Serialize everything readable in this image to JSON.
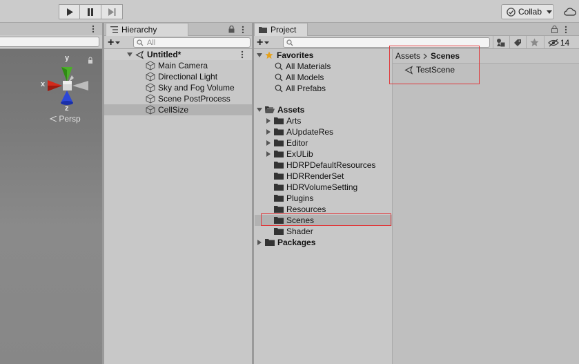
{
  "toolbar": {
    "play_icon": "play-icon",
    "pause_icon": "pause-icon",
    "step_icon": "step-icon",
    "collab_label": "Collab",
    "cloud_icon": "cloud-icon"
  },
  "scene": {
    "axis_y": "y",
    "axis_x": "x",
    "axis_z": "z",
    "projection_label": "Persp"
  },
  "hierarchy": {
    "tab_label": "Hierarchy",
    "search_placeholder": "All",
    "scene_name": "Untitled*",
    "items": [
      {
        "label": "Main Camera"
      },
      {
        "label": "Directional Light"
      },
      {
        "label": "Sky and Fog Volume"
      },
      {
        "label": "Scene PostProcess"
      },
      {
        "label": "CellSize"
      }
    ]
  },
  "project": {
    "tab_label": "Project",
    "hidden_count": "14",
    "favorites_label": "Favorites",
    "favorites": [
      {
        "label": "All Materials"
      },
      {
        "label": "All Models"
      },
      {
        "label": "All Prefabs"
      }
    ],
    "assets_label": "Assets",
    "assets": [
      {
        "label": "Arts",
        "expandable": true
      },
      {
        "label": "AUpdateRes",
        "expandable": true
      },
      {
        "label": "Editor",
        "expandable": true
      },
      {
        "label": "ExULib",
        "expandable": true
      },
      {
        "label": "HDRPDefaultResources",
        "expandable": false
      },
      {
        "label": "HDRRenderSet",
        "expandable": false
      },
      {
        "label": "HDRVolumeSetting",
        "expandable": false
      },
      {
        "label": "Plugins",
        "expandable": false
      },
      {
        "label": "Resources",
        "expandable": false
      },
      {
        "label": "Scenes",
        "expandable": false
      },
      {
        "label": "Shader",
        "expandable": false
      }
    ],
    "packages_label": "Packages",
    "breadcrumb": {
      "root": "Assets",
      "current": "Scenes"
    },
    "files": [
      {
        "label": "TestScene"
      }
    ]
  },
  "colors": {
    "highlight_box": "#e0383b",
    "favorite_star": "#e6a11a"
  }
}
